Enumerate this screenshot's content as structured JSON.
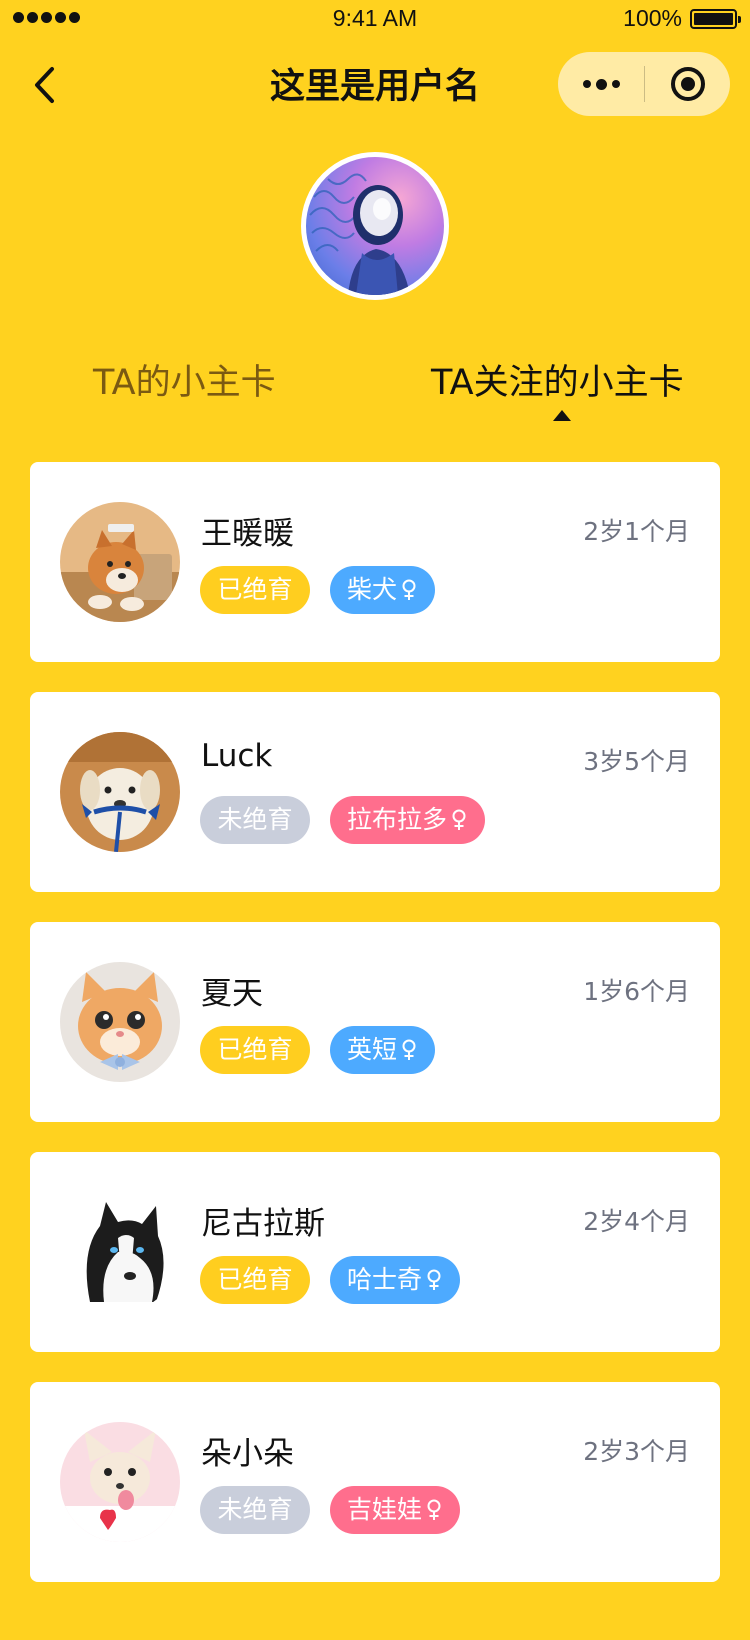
{
  "status_bar": {
    "time": "9:41 AM",
    "battery": "100%"
  },
  "nav": {
    "title": "这里是用户名"
  },
  "tabs": {
    "mine": "TA的小主卡",
    "following": "TA关注的小主卡"
  },
  "colors": {
    "background": "#FFD21F",
    "tag_yellow": "#FFCE1F",
    "tag_gray": "#C9CEDB",
    "tag_blue": "#4DAAFF",
    "tag_pink": "#FF6E8D"
  },
  "pets": [
    {
      "name": "王暖暖",
      "age": "2岁1个月",
      "neuter": "已绝育",
      "neuter_color": "#FFCE1F",
      "breed": "柴犬",
      "breed_color": "#4DAAFF",
      "gender_icon": "female-icon",
      "avatar": "shiba-avatar"
    },
    {
      "name": "Luck",
      "age": "3岁5个月",
      "neuter": "未绝育",
      "neuter_color": "#C9CEDB",
      "breed": "拉布拉多",
      "breed_color": "#FF6E8D",
      "gender_icon": "female-icon",
      "avatar": "labrador-avatar"
    },
    {
      "name": "夏天",
      "age": "1岁6个月",
      "neuter": "已绝育",
      "neuter_color": "#FFCE1F",
      "breed": "英短",
      "breed_color": "#4DAAFF",
      "gender_icon": "female-icon",
      "avatar": "cat-avatar"
    },
    {
      "name": "尼古拉斯",
      "age": "2岁4个月",
      "neuter": "已绝育",
      "neuter_color": "#FFCE1F",
      "breed": "哈士奇",
      "breed_color": "#4DAAFF",
      "gender_icon": "female-icon",
      "avatar": "husky-avatar"
    },
    {
      "name": "朵小朵",
      "age": "2岁3个月",
      "neuter": "未绝育",
      "neuter_color": "#C9CEDB",
      "breed": "吉娃娃",
      "breed_color": "#FF6E8D",
      "gender_icon": "female-icon",
      "avatar": "chihuahua-avatar"
    }
  ]
}
